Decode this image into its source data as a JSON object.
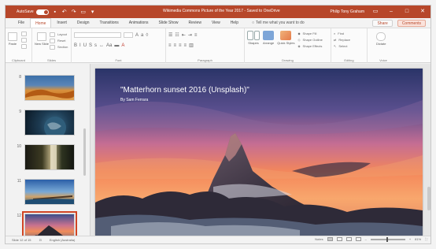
{
  "titlebar": {
    "autosave_label": "AutoSave",
    "title": "Wikimedia Commons Picture of the Year 2017 - Saved to OneDrive",
    "user": "Philip Tony Graham",
    "qat_icons": [
      "save-icon",
      "undo-icon",
      "redo-icon",
      "present-icon",
      "customize-icon"
    ]
  },
  "tabs": {
    "items": [
      "File",
      "Home",
      "Insert",
      "Design",
      "Transitions",
      "Animations",
      "Slide Show",
      "Review",
      "View",
      "Help"
    ],
    "active_index": 1,
    "tell_me": "Tell me what you want to do",
    "share": "Share",
    "comments": "Comments"
  },
  "ribbon": {
    "groups": [
      "Clipboard",
      "Slides",
      "Font",
      "Paragraph",
      "Drawing",
      "Editing",
      "Voice"
    ],
    "clipboard_paste": "Paste",
    "slides_new": "New Slide",
    "slides_layout": "Layout",
    "slides_reset": "Reset",
    "slides_section": "Section",
    "drawing_shapes": "Shapes",
    "drawing_arrange": "Arrange",
    "drawing_quick": "Quick Styles",
    "drawing_fill": "Shape Fill",
    "drawing_outline": "Shape Outline",
    "drawing_effects": "Shape Effects",
    "editing_find": "Find",
    "editing_replace": "Replace",
    "editing_select": "Select",
    "voice_dictate": "Dictate"
  },
  "thumbnails": [
    {
      "num": "8",
      "scene": "desert"
    },
    {
      "num": "9",
      "scene": "earth"
    },
    {
      "num": "10",
      "scene": "waterfall"
    },
    {
      "num": "11",
      "scene": "pier"
    },
    {
      "num": "12",
      "scene": "matterhorn",
      "selected": true
    }
  ],
  "slide": {
    "title": "\"Matterhorn sunset 2016 (Unsplash)\"",
    "subtitle": "By Sam Ferrara"
  },
  "status": {
    "slide_count": "Slide 12 of 15",
    "language": "English (Australia)",
    "notes": "Notes",
    "zoom": "81%"
  },
  "colors": {
    "accent": "#b7472a",
    "selection": "#d04423"
  }
}
